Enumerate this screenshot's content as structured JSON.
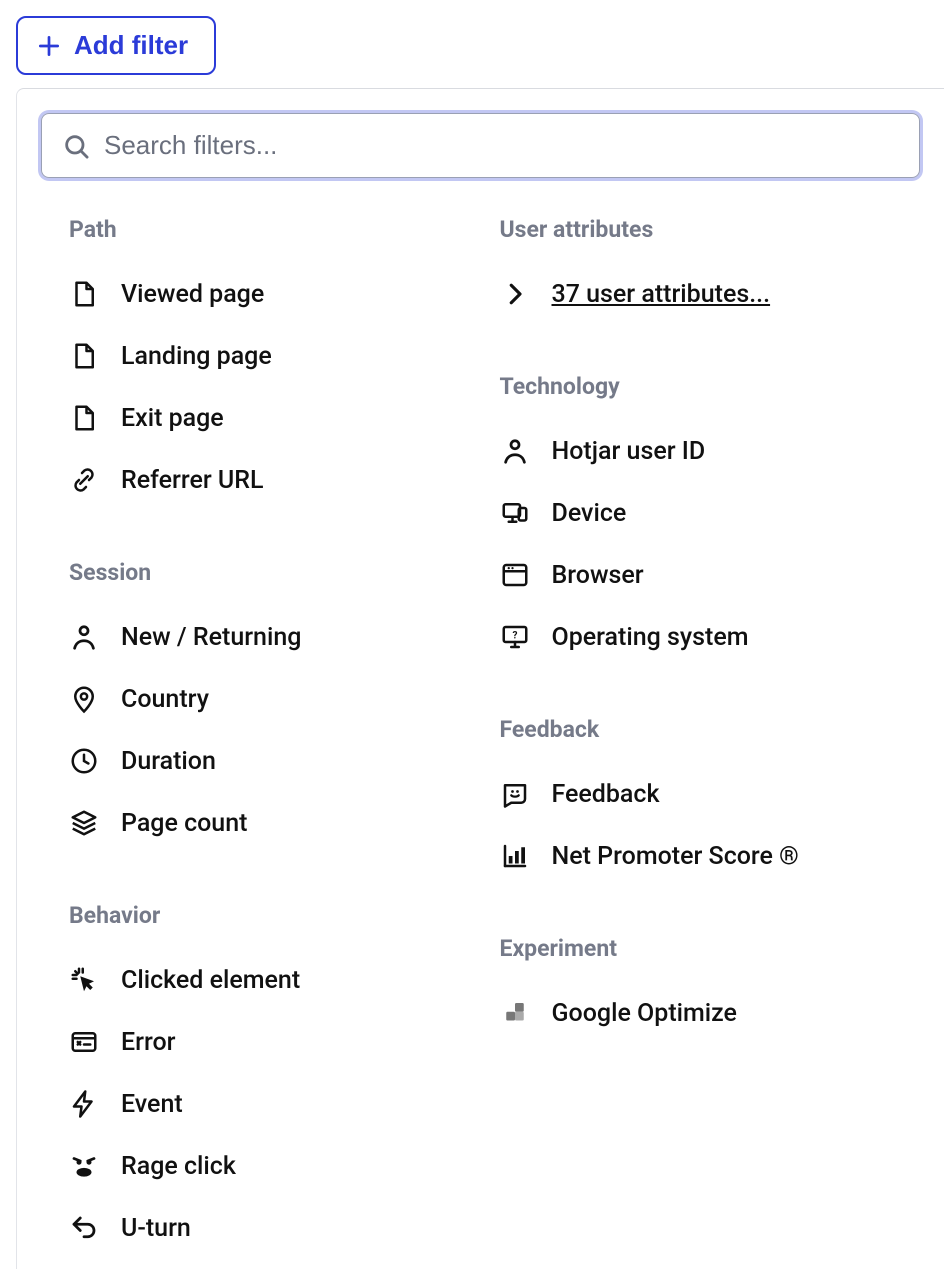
{
  "add_filter_label": "Add filter",
  "search_placeholder": "Search filters...",
  "groups_left": [
    {
      "title": "Path",
      "items": [
        {
          "label": "Viewed page",
          "icon": "page-icon"
        },
        {
          "label": "Landing page",
          "icon": "page-icon"
        },
        {
          "label": "Exit page",
          "icon": "page-icon"
        },
        {
          "label": "Referrer URL",
          "icon": "link-icon"
        }
      ]
    },
    {
      "title": "Session",
      "items": [
        {
          "label": "New / Returning",
          "icon": "user-icon"
        },
        {
          "label": "Country",
          "icon": "pin-icon"
        },
        {
          "label": "Duration",
          "icon": "clock-icon"
        },
        {
          "label": "Page count",
          "icon": "stack-icon"
        }
      ]
    },
    {
      "title": "Behavior",
      "items": [
        {
          "label": "Clicked element",
          "icon": "click-icon"
        },
        {
          "label": "Error",
          "icon": "error-icon"
        },
        {
          "label": "Event",
          "icon": "bolt-icon"
        },
        {
          "label": "Rage click",
          "icon": "rage-icon"
        },
        {
          "label": "U-turn",
          "icon": "uturn-icon"
        }
      ]
    }
  ],
  "groups_right": [
    {
      "title": "User attributes",
      "items": [
        {
          "label": "37 user attributes...",
          "icon": "chevron-right-icon",
          "underline": true
        }
      ]
    },
    {
      "title": "Technology",
      "items": [
        {
          "label": "Hotjar user ID",
          "icon": "user-icon"
        },
        {
          "label": "Device",
          "icon": "device-icon"
        },
        {
          "label": "Browser",
          "icon": "browser-icon"
        },
        {
          "label": "Operating system",
          "icon": "os-icon"
        }
      ]
    },
    {
      "title": "Feedback",
      "items": [
        {
          "label": "Feedback",
          "icon": "smile-icon"
        },
        {
          "label": "Net Promoter Score ®",
          "icon": "barchart-icon"
        }
      ]
    },
    {
      "title": "Experiment",
      "items": [
        {
          "label": "Google Optimize",
          "icon": "optimize-icon"
        }
      ]
    }
  ]
}
